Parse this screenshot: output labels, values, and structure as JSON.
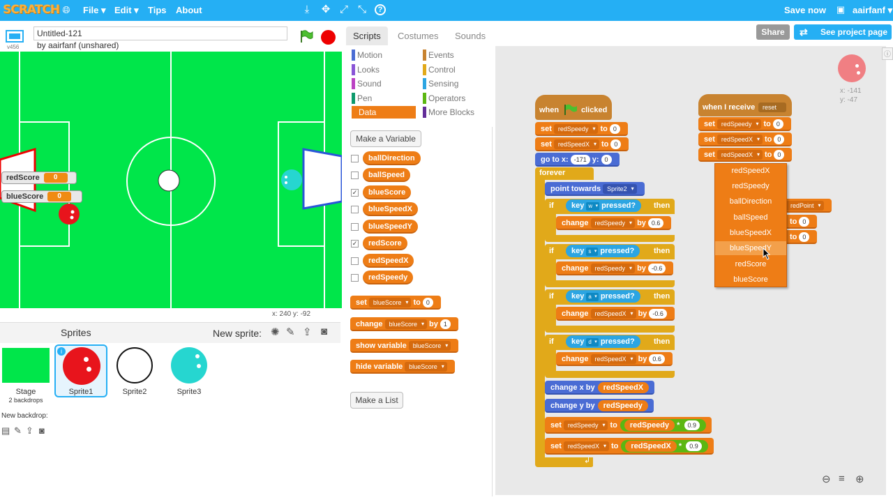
{
  "menubar": {
    "logo": "SCRATCH",
    "items": [
      "File ▾",
      "Edit ▾",
      "Tips",
      "About"
    ],
    "save_now": "Save now",
    "user": "aairfanf ▾"
  },
  "project": {
    "title": "Untitled-121",
    "author": "by aairfanf (unshared)",
    "version": "v456",
    "share_label": "Share",
    "see_page_label": "See project page"
  },
  "stage": {
    "monitors": [
      {
        "name": "redScore",
        "value": "0"
      },
      {
        "name": "blueScore",
        "value": "0"
      }
    ],
    "mouse_coords": "x: 240   y: -92"
  },
  "sprites": {
    "header": "Sprites",
    "new_sprite": "New sprite:",
    "stage_label": "Stage",
    "stage_sub": "2 backdrops",
    "new_backdrop": "New backdrop:",
    "items": [
      {
        "name": "Sprite1"
      },
      {
        "name": "Sprite2"
      },
      {
        "name": "Sprite3"
      }
    ]
  },
  "tabs": [
    "Scripts",
    "Costumes",
    "Sounds"
  ],
  "categories": [
    {
      "label": "Motion",
      "color": "#4a6cd4"
    },
    {
      "label": "Events",
      "color": "#c88330"
    },
    {
      "label": "Looks",
      "color": "#8a55d7"
    },
    {
      "label": "Control",
      "color": "#e1a91a"
    },
    {
      "label": "Sound",
      "color": "#bb42c3"
    },
    {
      "label": "Sensing",
      "color": "#2ca5e2"
    },
    {
      "label": "Pen",
      "color": "#0e9a6c"
    },
    {
      "label": "Operators",
      "color": "#5cb712"
    },
    {
      "label": "Data",
      "color": "#ee7d16"
    },
    {
      "label": "More Blocks",
      "color": "#632d99"
    }
  ],
  "palette": {
    "make_variable": "Make a Variable",
    "make_list": "Make a List",
    "variables": [
      {
        "name": "ballDirection",
        "checked": ""
      },
      {
        "name": "ballSpeed",
        "checked": ""
      },
      {
        "name": "blueScore",
        "checked": "✓"
      },
      {
        "name": "blueSpeedX",
        "checked": ""
      },
      {
        "name": "blueSpeedY",
        "checked": ""
      },
      {
        "name": "redScore",
        "checked": "✓"
      },
      {
        "name": "redSpeedX",
        "checked": ""
      },
      {
        "name": "redSpeedy",
        "checked": ""
      }
    ],
    "blocks": {
      "set": "set",
      "set_var": "blueScore",
      "to": "to",
      "set_val": "0",
      "change": "change",
      "change_var": "blueScore",
      "by": "by",
      "change_val": "1",
      "show": "show variable",
      "show_var": "blueScore",
      "hide": "hide variable",
      "hide_var": "blueScore"
    }
  },
  "script1": {
    "hat_when": "when",
    "hat_clicked": "clicked",
    "set1_var": "redSpeedy",
    "set1_val": "0",
    "set2_var": "redSpeedX",
    "set2_val": "0",
    "goto": "go to x:",
    "goto_x": "-171",
    "goto_y_label": "y:",
    "goto_y": "0",
    "forever": "forever",
    "point": "point towards",
    "point_target": "Sprite2",
    "if": "if",
    "then": "then",
    "key": "key",
    "pressed": "pressed?",
    "ifs": [
      {
        "key": "w",
        "var": "redSpeedy",
        "val": "0.6"
      },
      {
        "key": "s",
        "var": "redSpeedy",
        "val": "-0.6"
      },
      {
        "key": "a",
        "var": "redSpeedX",
        "val": "-0.6"
      },
      {
        "key": "d",
        "var": "redSpeedX",
        "val": "0.6"
      }
    ],
    "change_label": "change",
    "by_label": "by",
    "chx": "change x by",
    "chx_var": "redSpeedX",
    "chy": "change y by",
    "chy_var": "redSpeedy",
    "mul1_target": "redSpeedy",
    "mul1_var": "redSpeedy",
    "mul1_val": "0.9",
    "mul2_target": "redSpeedX",
    "mul2_var": "redSpeedX",
    "mul2_val": "0.9",
    "set_label": "set",
    "to_label": "to",
    "times": "*"
  },
  "script2": {
    "hat": "when I receive",
    "hat_msg": "reset",
    "rows": [
      {
        "var": "redSpeedy",
        "val": "0"
      },
      {
        "var": "redSpeedX",
        "val": "0"
      },
      {
        "var": "redSpeedX",
        "val": "0"
      }
    ],
    "hidden_frag": "redPoint",
    "hidden_val1": "0",
    "hidden_val2": "0"
  },
  "dropdown_menu": [
    "redSpeedX",
    "redSpeedy",
    "ballDirection",
    "ballSpeed",
    "blueSpeedX",
    "blueSpeedY",
    "redScore",
    "blueScore"
  ],
  "sprite_info": {
    "x": "x: -141",
    "y": "y: -47"
  },
  "colors": {
    "menubar": "#25aff4",
    "data": "#ee7d16",
    "control": "#e1a91a",
    "sensing": "#2ca5e2",
    "operators": "#5cb712",
    "stage_bg": "#00e64a"
  }
}
